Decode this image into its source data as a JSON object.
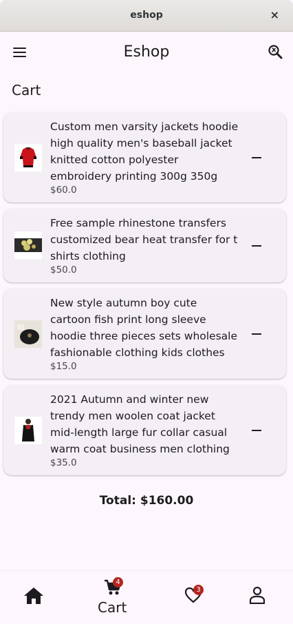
{
  "window": {
    "title": "eshop",
    "close_glyph": "×"
  },
  "appbar": {
    "title": "Eshop",
    "menu_icon": "menu-icon",
    "search_icon": "search-icon"
  },
  "page": {
    "heading": "Cart"
  },
  "cart": {
    "items": [
      {
        "name": "Custom men varsity jackets hoodie high quality men's baseball jacket knitted cotton polyester embroidery printing 300g 350g",
        "price": "$60.0"
      },
      {
        "name": "Free sample rhinestone transfers customized bear heat transfer for t shirts clothing",
        "price": "$50.0"
      },
      {
        "name": "New style autumn boy cute cartoon fish print long sleeve hoodie three pieces sets wholesale fashionable clothing kids clothes",
        "price": "$15.0"
      },
      {
        "name": "2021 Autumn and winter new trendy men woolen coat jacket mid-length large fur collar casual warm coat business men clothing",
        "price": "$35.0"
      }
    ],
    "total": "Total: $160.00"
  },
  "nav": {
    "cart_label": "Cart",
    "cart_badge": "4",
    "wishlist_badge": "3"
  },
  "colors": {
    "background": "#fdf7fd",
    "card": "#f4eef5",
    "badge": "#b3261e",
    "text": "#1d1b20"
  }
}
